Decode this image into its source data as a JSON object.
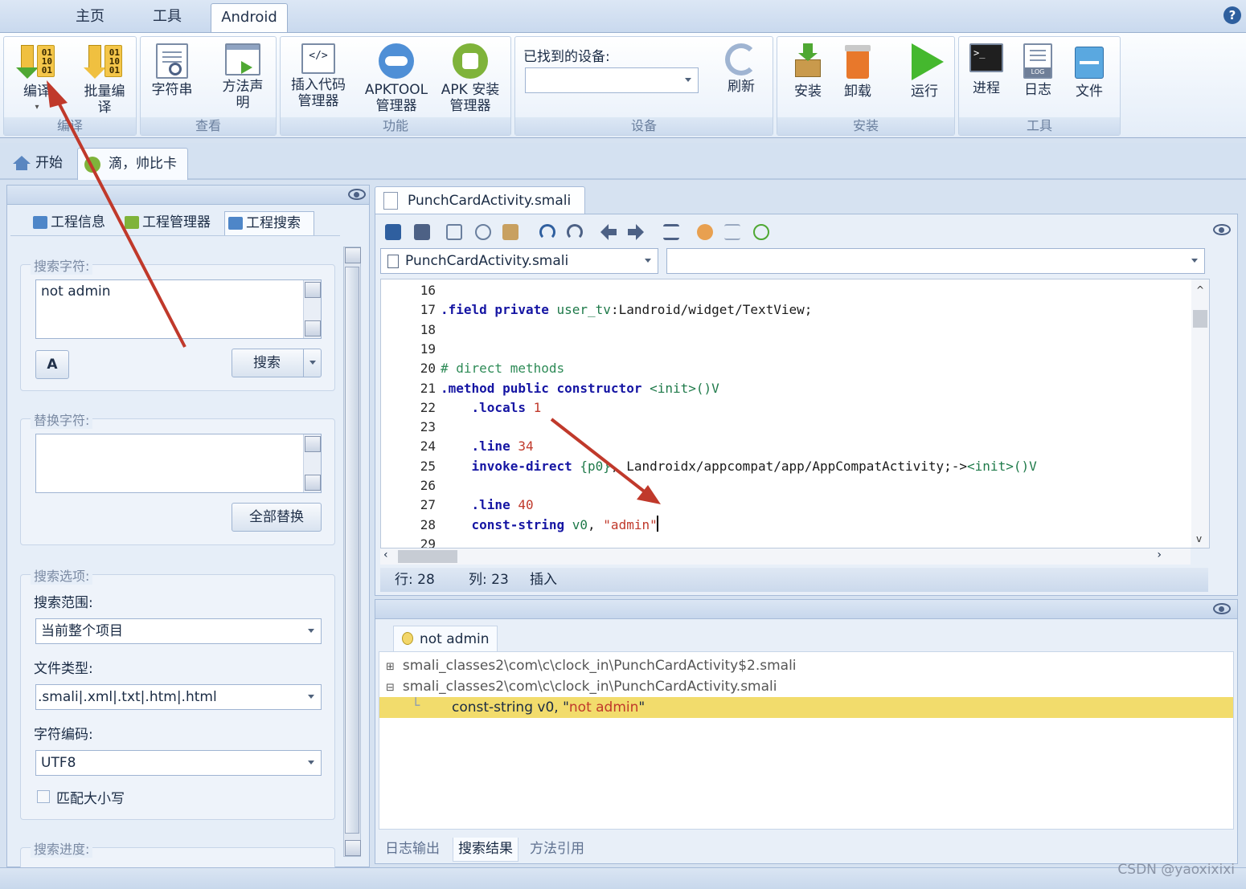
{
  "ribbon_tabs": [
    "主页",
    "工具",
    "Android"
  ],
  "help": "?",
  "groups": {
    "compile": {
      "label": "编译",
      "buttons": [
        "编译",
        "批量编译"
      ]
    },
    "view": {
      "label": "查看",
      "buttons": [
        "字符串",
        "方法声明"
      ]
    },
    "function": {
      "label": "功能",
      "buttons": [
        "插入代码管理器",
        "APKTOOL管理器",
        "APK 安装管理器"
      ]
    },
    "device": {
      "label": "设备",
      "found_label": "已找到的设备:",
      "device_value": "",
      "refresh": "刷新"
    },
    "install": {
      "label": "安装",
      "buttons": [
        "安装",
        "卸载",
        "运行"
      ]
    },
    "tools": {
      "label": "工具",
      "buttons": [
        "进程",
        "日志",
        "文件"
      ]
    }
  },
  "doc_tabs": [
    "开始",
    "滴，帅比卡"
  ],
  "left_tabs": [
    "工程信息",
    "工程管理器",
    "工程搜索"
  ],
  "search": {
    "legend": "搜索字符:",
    "query": "not admin",
    "font_btn": "A",
    "search_btn": "搜索"
  },
  "replace": {
    "legend": "替换字符:",
    "value": "",
    "replace_all_btn": "全部替换"
  },
  "options": {
    "legend": "搜索选项:",
    "scope_label": "搜索范围:",
    "scope_value": "当前整个项目",
    "filetype_label": "文件类型:",
    "filetype_value": ".smali|.xml|.txt|.htm|.html",
    "encoding_label": "字符编码:",
    "encoding_value": "UTF8",
    "match_case": "匹配大小写"
  },
  "progress_legend": "搜索进度:",
  "editor": {
    "tab_title": "PunchCardActivity.smali",
    "file_combo": "PunchCardActivity.smali",
    "member_combo": "",
    "lines": [
      {
        "n": "16",
        "parts": []
      },
      {
        "n": "17",
        "parts": [
          {
            "c": "k",
            "t": ".field private "
          },
          {
            "c": "g",
            "t": "user_tv"
          },
          {
            "c": "t",
            "t": ":Landroid/widget/TextView;"
          }
        ]
      },
      {
        "n": "18",
        "parts": []
      },
      {
        "n": "19",
        "parts": []
      },
      {
        "n": "20",
        "parts": [
          {
            "c": "cm",
            "t": "# direct methods"
          }
        ]
      },
      {
        "n": "21",
        "parts": [
          {
            "c": "k",
            "t": ".method public constructor "
          },
          {
            "c": "g",
            "t": "<init>()V"
          }
        ]
      },
      {
        "n": "22",
        "parts": [
          {
            "c": "k",
            "t": "    .locals "
          },
          {
            "c": "s",
            "t": "1"
          }
        ]
      },
      {
        "n": "23",
        "parts": []
      },
      {
        "n": "24",
        "parts": [
          {
            "c": "k",
            "t": "    .line "
          },
          {
            "c": "s",
            "t": "34"
          }
        ]
      },
      {
        "n": "25",
        "parts": [
          {
            "c": "k",
            "t": "    invoke-direct "
          },
          {
            "c": "g",
            "t": "{p0}"
          },
          {
            "c": "t",
            "t": ", Landroidx/appcompat/app/AppCompatActivity;->"
          },
          {
            "c": "g",
            "t": "<init>()V"
          }
        ]
      },
      {
        "n": "26",
        "parts": []
      },
      {
        "n": "27",
        "parts": [
          {
            "c": "k",
            "t": "    .line "
          },
          {
            "c": "s",
            "t": "40"
          }
        ]
      },
      {
        "n": "28",
        "parts": [
          {
            "c": "k",
            "t": "    const-string "
          },
          {
            "c": "g",
            "t": "v0"
          },
          {
            "c": "t",
            "t": ", "
          },
          {
            "c": "s",
            "t": "\"admin\""
          }
        ]
      },
      {
        "n": "29",
        "parts": []
      }
    ],
    "status": {
      "row": "行: 28",
      "col": "列: 23",
      "mode": "插入"
    }
  },
  "results": {
    "tab": "not admin",
    "items": [
      {
        "prefix": "⊞",
        "text": "smali_classes2\\com\\c\\clock_in\\PunchCardActivity$2.smali"
      },
      {
        "prefix": "⊟",
        "text": "smali_classes2\\com\\c\\clock_in\\PunchCardActivity.smali"
      }
    ],
    "match_prefix": "const-string v0, \"",
    "match_hit": "not admin",
    "match_suffix": "\"",
    "bottom_tabs": [
      "日志输出",
      "搜索结果",
      "方法引用"
    ]
  },
  "watermark": "CSDN @yaoxixixi",
  "colors": {
    "accent_blue": "#2e5f9e",
    "highlight": "#f2dc6c",
    "arrow_red": "#c0392b"
  }
}
